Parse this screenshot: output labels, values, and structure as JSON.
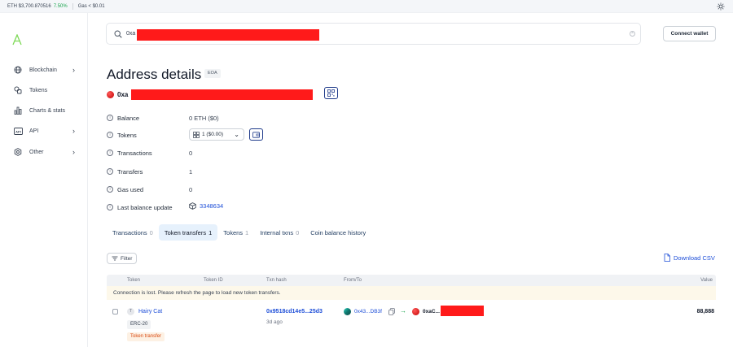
{
  "topbar": {
    "eth_price": "ETH $3,700.870516",
    "eth_change": "7.50%",
    "gas": "Gas < $0.01"
  },
  "sidebar": {
    "items": [
      {
        "label": "Blockchain",
        "icon": "cube-icon"
      },
      {
        "label": "Tokens",
        "icon": "tokens-icon"
      },
      {
        "label": "Charts & stats",
        "icon": "chart-icon"
      },
      {
        "label": "API",
        "icon": "api-icon"
      },
      {
        "label": "Other",
        "icon": "gear-icon"
      }
    ]
  },
  "search": {
    "value": "0xa"
  },
  "header": {
    "connect_label": "Connect wallet",
    "title": "Address details",
    "badge": "EOA",
    "address_prefix": "0xa"
  },
  "details": {
    "balance_label": "Balance",
    "balance_value": "0 ETH ($0)",
    "tokens_label": "Tokens",
    "tokens_value": "1 ($0.00)",
    "transactions_label": "Transactions",
    "transactions_value": "0",
    "transfers_label": "Transfers",
    "transfers_value": "1",
    "gas_label": "Gas used",
    "gas_value": "0",
    "last_update_label": "Last balance update",
    "last_update_value": "3348634"
  },
  "tabs": [
    {
      "label": "Transactions",
      "count": "0"
    },
    {
      "label": "Token transfers",
      "count": "1"
    },
    {
      "label": "Tokens",
      "count": "1"
    },
    {
      "label": "Internal txns",
      "count": "0"
    },
    {
      "label": "Coin balance history",
      "count": ""
    }
  ],
  "toolbar": {
    "filter_label": "Filter",
    "download_label": "Download CSV"
  },
  "table": {
    "headers": [
      "Token",
      "Token ID",
      "Txn hash",
      "From/To",
      "Value"
    ],
    "alert": "Connection is lost. Please refresh the page to load new token transfers.",
    "row": {
      "token_icon_letter": "T",
      "token": "Hairy Cat",
      "standard": "ERC-20",
      "type": "Token transfer",
      "hash": "0x9518cd14e5...25d3",
      "age": "3d ago",
      "from": "0x43...DB3f",
      "to": "0xaC...",
      "value": "88,888"
    }
  },
  "colors": {
    "accent": "#1d4ed8",
    "redaction": "#ff1a1a",
    "logo": "#7ed957"
  }
}
